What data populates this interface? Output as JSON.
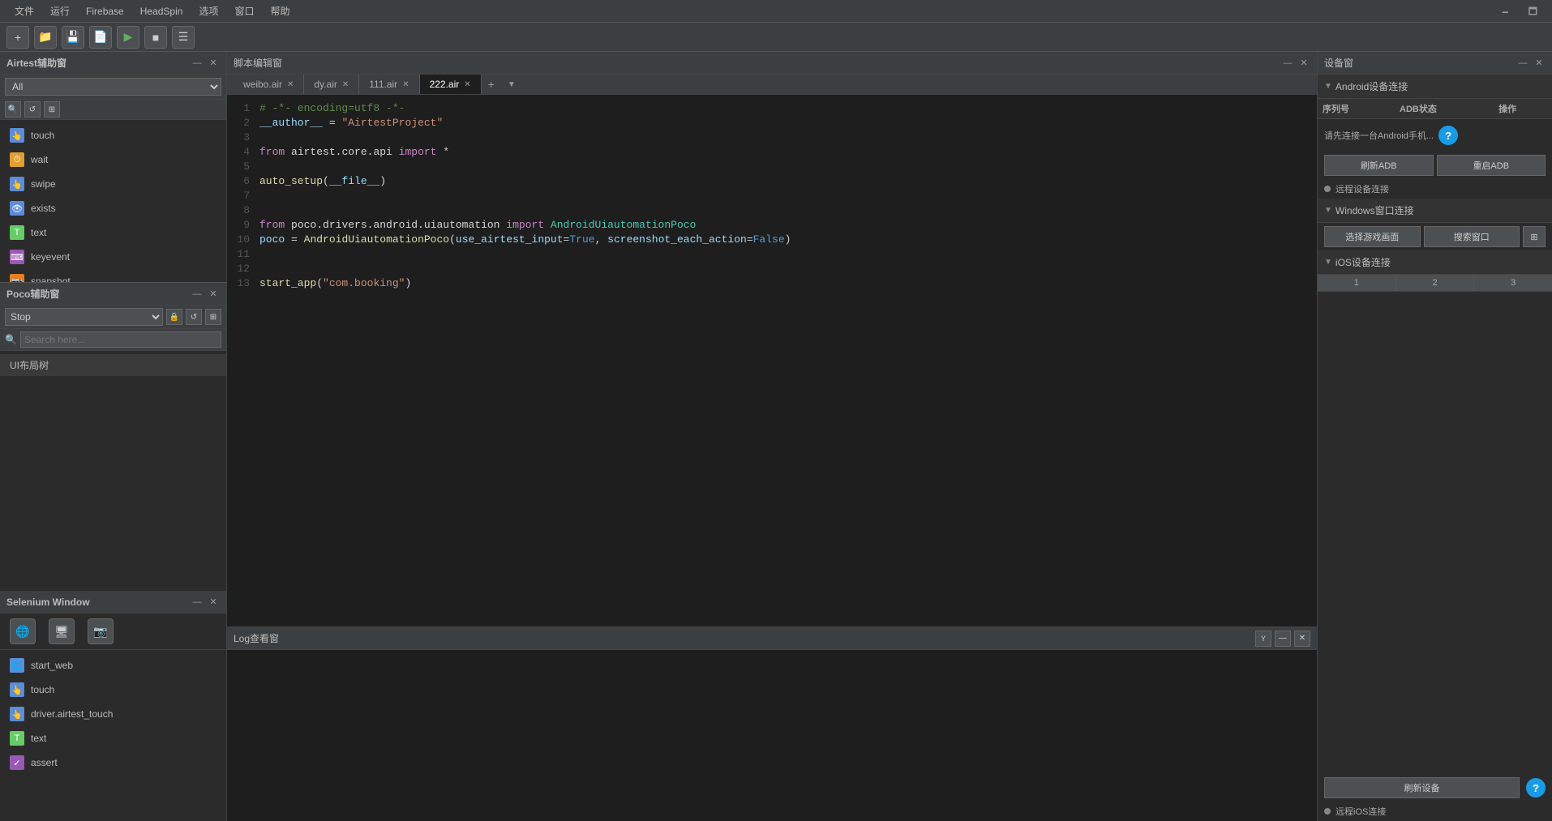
{
  "menu": {
    "items": [
      "文件",
      "运行",
      "Firebase",
      "HeadSpin",
      "选项",
      "窗口",
      "帮助"
    ]
  },
  "toolbar": {
    "buttons": [
      "new",
      "open",
      "save",
      "save-as",
      "run",
      "stop"
    ]
  },
  "airtest_panel": {
    "title": "Airtest辅助窗",
    "filter_label": "All",
    "filter_options": [
      "All",
      "touch",
      "wait",
      "swipe",
      "exists",
      "text",
      "keyevent",
      "snapshot"
    ],
    "items": [
      {
        "label": "touch",
        "icon": "👆"
      },
      {
        "label": "wait",
        "icon": "⏱"
      },
      {
        "label": "swipe",
        "icon": "👆"
      },
      {
        "label": "exists",
        "icon": "👆"
      },
      {
        "label": "text",
        "icon": "T"
      },
      {
        "label": "keyevent",
        "icon": "⌨"
      },
      {
        "label": "snapshot",
        "icon": "📷"
      }
    ]
  },
  "poco_panel": {
    "title": "Poco辅助窗",
    "filter_label": "Stop",
    "search_placeholder": "Search here...",
    "tree_item": "UI布局树"
  },
  "selenium_panel": {
    "title": "Selenium Window",
    "items": [
      {
        "label": "start_web",
        "icon": "🌐"
      },
      {
        "label": "touch",
        "icon": "👆"
      },
      {
        "label": "driver.airtest_touch",
        "icon": "👆"
      },
      {
        "label": "text",
        "icon": "T"
      },
      {
        "label": "assert",
        "icon": "✓"
      }
    ]
  },
  "editor": {
    "title": "脚本编辑窗",
    "tabs": [
      {
        "label": "weibo.air",
        "active": false
      },
      {
        "label": "dy.air",
        "active": false
      },
      {
        "label": "111.air",
        "active": false
      },
      {
        "label": "222.air",
        "active": true
      }
    ],
    "code_lines": [
      {
        "num": 1,
        "content": "# -*- encoding=utf8 -*-"
      },
      {
        "num": 2,
        "content": "__author__ = \"AirtestProject\""
      },
      {
        "num": 3,
        "content": ""
      },
      {
        "num": 4,
        "content": "from airtest.core.api import *"
      },
      {
        "num": 5,
        "content": ""
      },
      {
        "num": 6,
        "content": "auto_setup(__file__)"
      },
      {
        "num": 7,
        "content": ""
      },
      {
        "num": 8,
        "content": ""
      },
      {
        "num": 9,
        "content": "from poco.drivers.android.uiautomation import AndroidUiautomationPoco"
      },
      {
        "num": 10,
        "content": "poco = AndroidUiautomationPoco(use_airtest_input=True, screenshot_each_action=False)"
      },
      {
        "num": 11,
        "content": ""
      },
      {
        "num": 12,
        "content": ""
      },
      {
        "num": 13,
        "content": "start_app(\"com.booking\")"
      }
    ]
  },
  "log_panel": {
    "title": "Log查看窗"
  },
  "device_panel": {
    "title": "设备窗",
    "android_section": {
      "title": "Android设备连接",
      "columns": [
        "序列号",
        "ADB状态",
        "操作"
      ],
      "status_msg": "请先连接一台Android手机...",
      "refresh_adb": "刷新ADB",
      "reset_adb": "重启ADB",
      "remote_conn_label": "远程设备连接"
    },
    "windows_section": {
      "title": "Windows窗口连接",
      "btn_game": "选择游戏画面",
      "btn_search": "搜索窗口"
    },
    "ios_section": {
      "title": "iOS设备连接",
      "tabs": [
        "1",
        "2",
        "3"
      ],
      "refresh_label": "刷新设备",
      "remote_conn_label": "远程iOS连接"
    }
  }
}
